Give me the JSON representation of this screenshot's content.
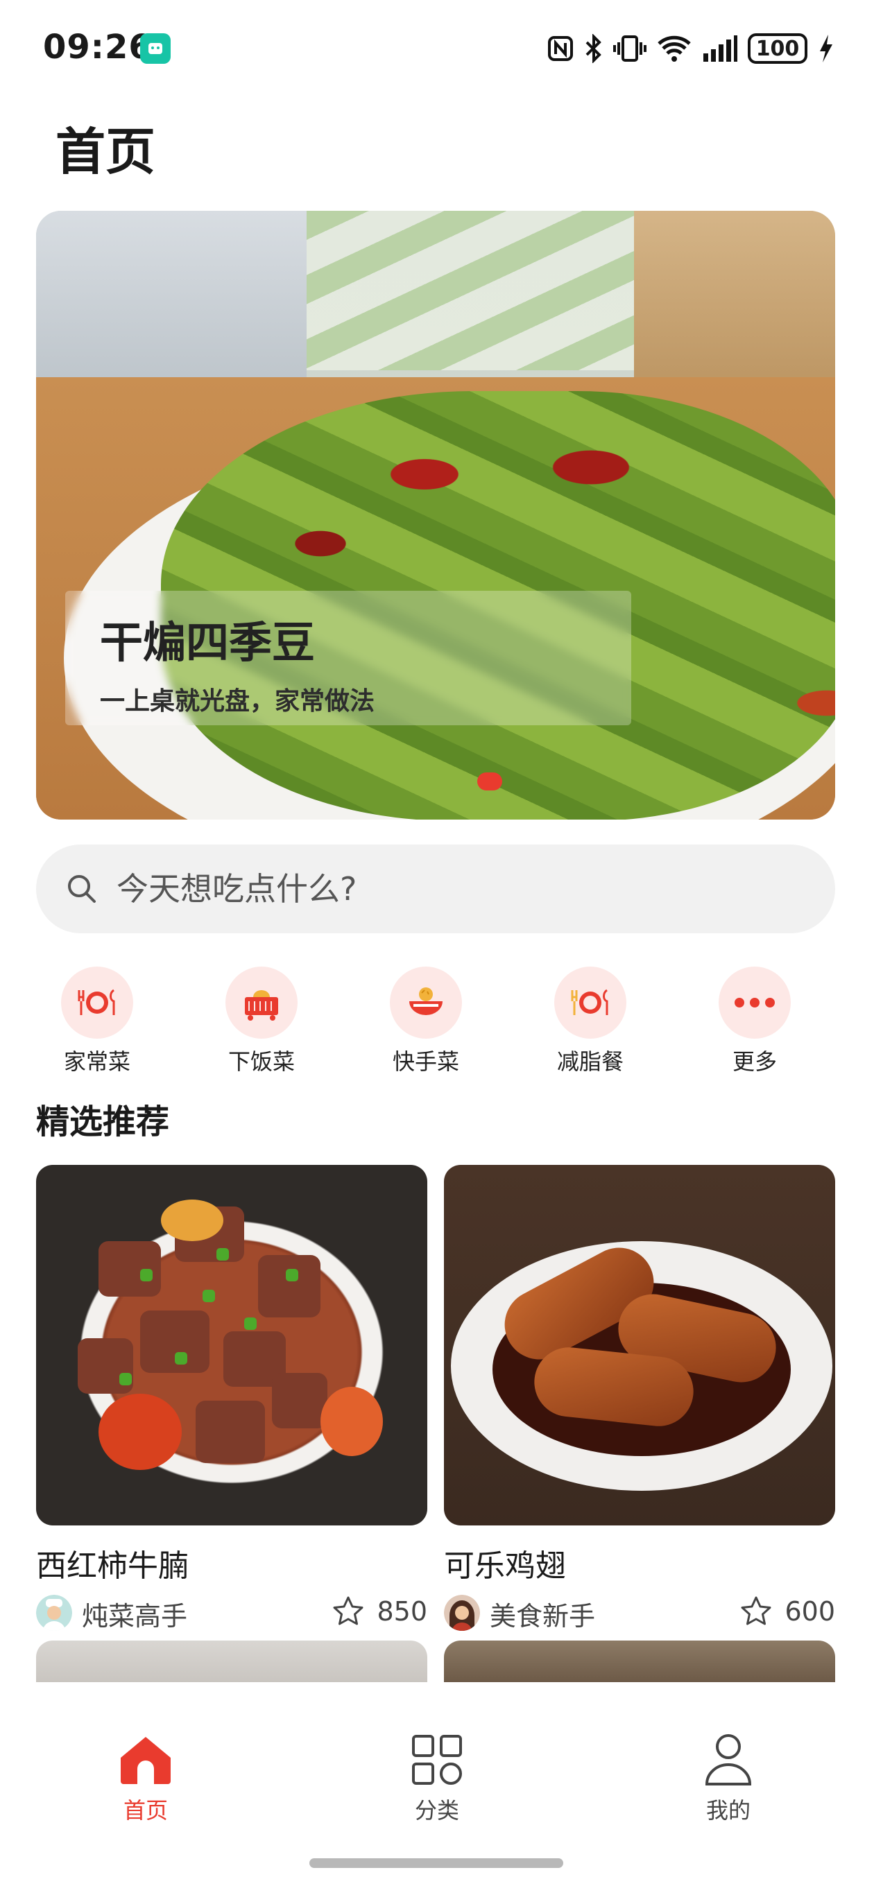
{
  "status_bar": {
    "time": "09:26",
    "battery": "100",
    "icons": [
      "mi-app-icon",
      "nfc-icon",
      "bluetooth-icon",
      "vibrate-icon",
      "wifi-icon",
      "signal-icon",
      "charging-icon"
    ]
  },
  "page": {
    "title": "首页"
  },
  "banner": {
    "title": "干煸四季豆",
    "subtitle": "一上桌就光盘，家常做法",
    "slide_count": 1,
    "active_slide": 1
  },
  "search": {
    "placeholder": "今天想吃点什么?"
  },
  "categories": [
    {
      "label": "家常菜",
      "icon": "plate-cutlery-icon"
    },
    {
      "label": "下饭菜",
      "icon": "rice-cart-icon"
    },
    {
      "label": "快手菜",
      "icon": "bowl-icon"
    },
    {
      "label": "减脂餐",
      "icon": "plate-cutlery-icon"
    },
    {
      "label": "更多",
      "icon": "more-dots-icon"
    }
  ],
  "section": {
    "title": "精选推荐"
  },
  "recipes": [
    {
      "title": "西红柿牛腩",
      "author": "炖菜高手",
      "likes": "850"
    },
    {
      "title": "可乐鸡翅",
      "author": "美食新手",
      "likes": "600"
    }
  ],
  "nav": {
    "items": [
      {
        "label": "首页",
        "icon": "home-icon",
        "active": true
      },
      {
        "label": "分类",
        "icon": "grid-icon",
        "active": false
      },
      {
        "label": "我的",
        "icon": "user-icon",
        "active": false
      }
    ]
  },
  "colors": {
    "accent": "#e93b2e",
    "category_bg": "#fde8e6",
    "search_bg": "#f1f1f1"
  }
}
